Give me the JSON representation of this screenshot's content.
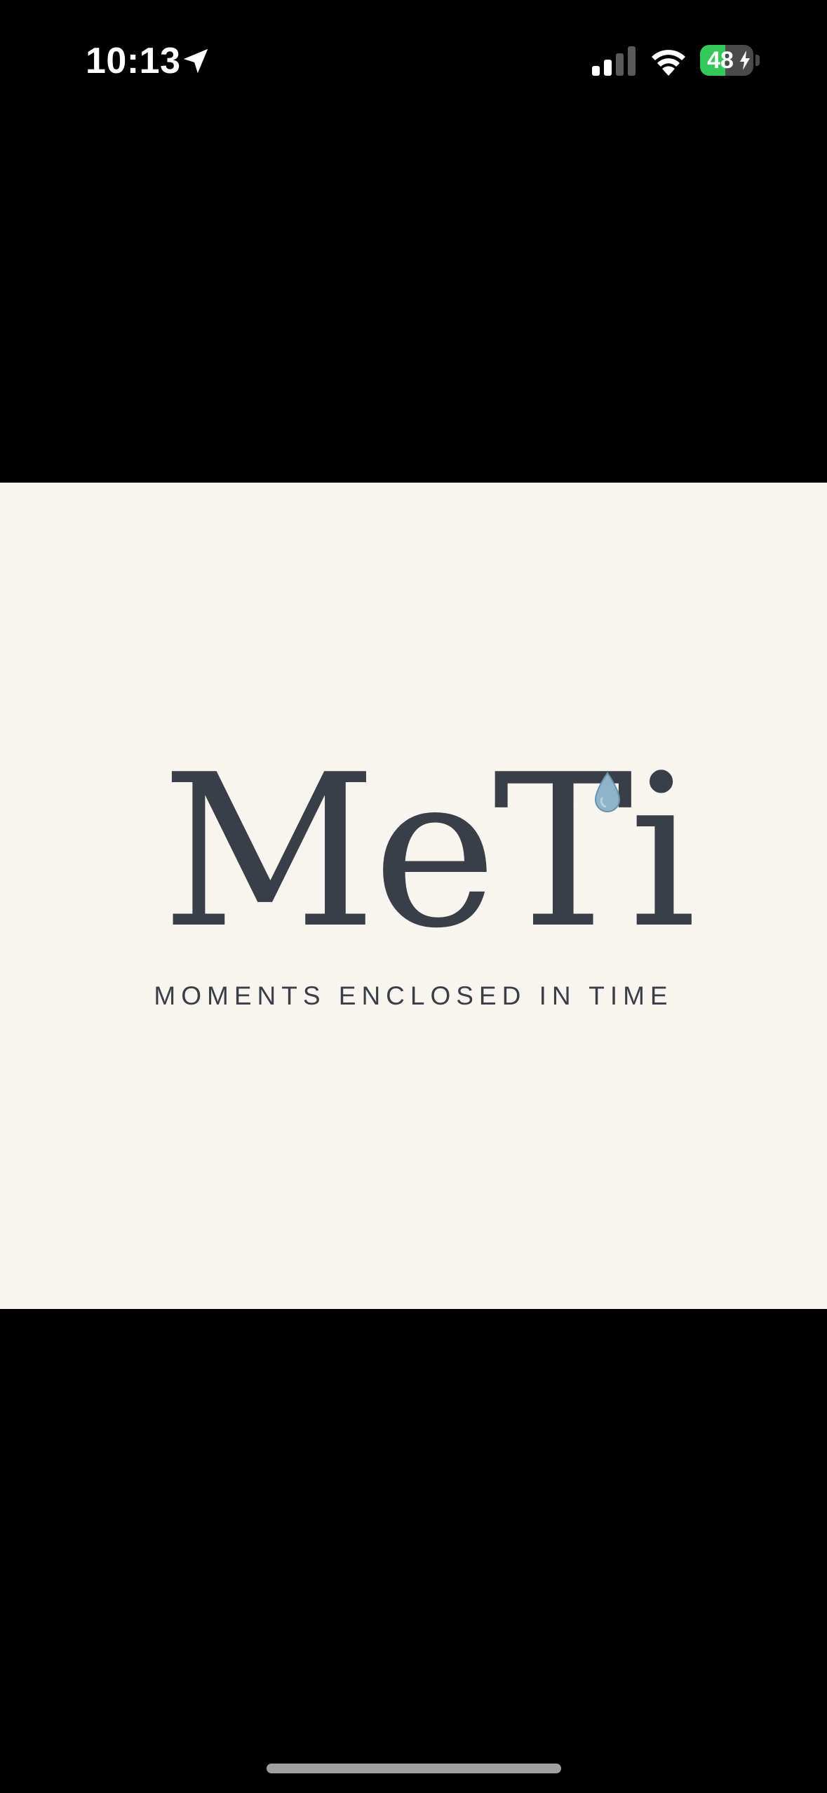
{
  "status_bar": {
    "time": "10:13",
    "battery_level": "48",
    "battery_fraction": 0.48,
    "icons": [
      "location-arrow-icon",
      "cellular-signal-icon",
      "wifi-icon",
      "battery-icon",
      "charging-bolt-icon"
    ]
  },
  "splash": {
    "logo": "MeTi",
    "tagline": "MOMENTS ENCLOSED IN TIME",
    "drop_icon": "water-drop-icon"
  },
  "colors": {
    "background": "#000000",
    "splash_background": "#f8f5f0",
    "logo_text": "#3a3f47",
    "drop": "#8fb3c9",
    "battery_fill": "#34c759"
  }
}
